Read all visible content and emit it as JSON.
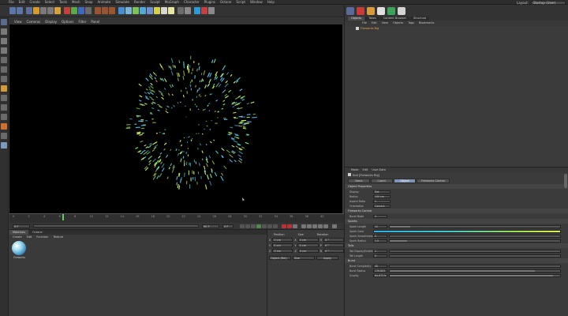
{
  "menu": [
    "File",
    "Edit",
    "Create",
    "Select",
    "Tools",
    "Mesh",
    "Snap",
    "Animate",
    "Simulate",
    "Render",
    "Sculpt",
    "MoGraph",
    "Character",
    "Plugins",
    "Octane",
    "Script",
    "Window",
    "Help"
  ],
  "layout": {
    "label": "Layout:",
    "value": "Startup (User)"
  },
  "viewport": {
    "menu": [
      "View",
      "Cameras",
      "Display",
      "Options",
      "Filter",
      "Panel"
    ],
    "particles": {
      "count": 420,
      "colors": [
        "#3ec9d6",
        "#8fe05a",
        "#d8e84a",
        "#5fb3e8",
        "#b8f070"
      ]
    }
  },
  "timeline": {
    "ticks": [
      "0",
      "2",
      "4",
      "6",
      "8",
      "10",
      "12",
      "14",
      "16",
      "18",
      "20",
      "22",
      "24",
      "26",
      "28",
      "30",
      "32",
      "34",
      "36",
      "38",
      "40"
    ],
    "start": "0 F",
    "end": "90 F",
    "current": "0 F"
  },
  "materials": {
    "tabs": [
      "Materials",
      "Octane"
    ],
    "menu": [
      "Create",
      "Edit",
      "Function",
      "Texture"
    ],
    "items": [
      {
        "name": "Fireworks"
      }
    ]
  },
  "coords": {
    "headers": [
      "Position",
      "Size",
      "Rotation"
    ],
    "rows": [
      {
        "axis": "X",
        "pos": "0 cm",
        "size": "0 cm",
        "rot_axis": "H",
        "rot": "0 °"
      },
      {
        "axis": "Y",
        "pos": "0 cm",
        "size": "0 cm",
        "rot_axis": "P",
        "rot": "0 °"
      },
      {
        "axis": "Z",
        "pos": "0 cm",
        "size": "0 cm",
        "rot_axis": "B",
        "rot": "0 °"
      }
    ],
    "mode": "Object (Rel)",
    "size_mode": "Size",
    "apply": "Apply"
  },
  "objects": {
    "tabs": [
      "Objects",
      "Takes",
      "Content Browser",
      "Structure"
    ],
    "menu": [
      "File",
      "Edit",
      "View",
      "Objects",
      "Tags",
      "Bookmarks"
    ],
    "items": [
      {
        "name": "Fireworks Rig"
      }
    ]
  },
  "attributes": {
    "menu": [
      "Mode",
      "Edit",
      "User Data"
    ],
    "title": "Null [Fireworks Rig]",
    "tabs": [
      "Basic",
      "Coord.",
      "Object",
      "Fireworks Control"
    ],
    "active_tab": "Object",
    "object_props": {
      "header": "Object Properties",
      "rows": [
        {
          "label": "Display",
          "value": "Dot"
        },
        {
          "label": "Radius",
          "value": "100 cm"
        },
        {
          "label": "Aspect Ratio",
          "value": "1"
        },
        {
          "label": "Orientation",
          "value": "Camera"
        }
      ]
    },
    "control": {
      "header": "Fireworks Control",
      "burst_mode": {
        "label": "Burst Mode",
        "value": "1"
      },
      "sparks": {
        "header": "Sparks",
        "rows": [
          {
            "label": "Spark Length",
            "value": "12",
            "fill": 0.12
          },
          {
            "label": "Spark Color",
            "value": "",
            "fill": 1.0,
            "gradient": true
          },
          {
            "label": "Spark Smoothness",
            "value": "0",
            "fill": 0.0
          },
          {
            "label": "Spark Radius",
            "value": "1.5",
            "fill": 0.1
          }
        ]
      },
      "tails": {
        "header": "Tails",
        "rows": [
          {
            "label": "Tail Display/Enable",
            "value": "1",
            "fill": 0
          },
          {
            "label": "Tail Length",
            "value": "0",
            "fill": 0
          }
        ]
      },
      "burst": {
        "header": "Burst",
        "rows": [
          {
            "label": "Burst Complexity",
            "value": "40",
            "fill": 0.0
          },
          {
            "label": "Burst Radius",
            "value": "176.803",
            "fill": 0.85
          },
          {
            "label": "Gravity",
            "value": "84.673 N",
            "fill": 0.96
          }
        ]
      }
    }
  }
}
